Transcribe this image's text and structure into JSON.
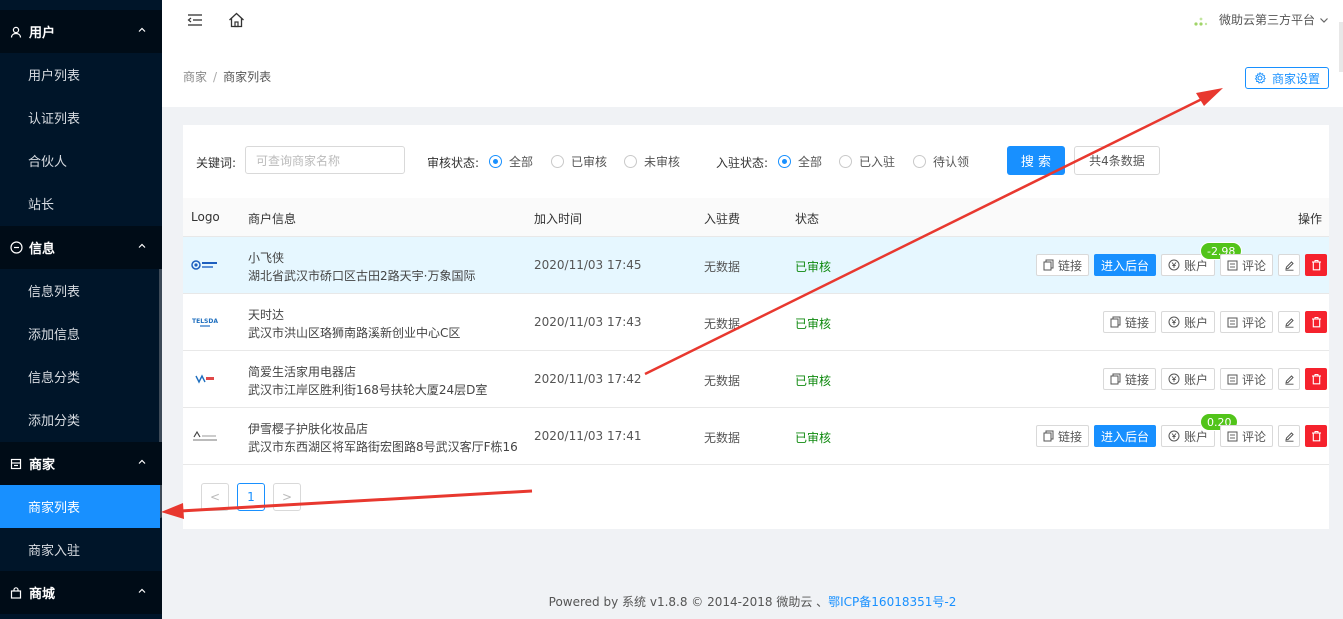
{
  "sidebar": {
    "groups": {
      "user": {
        "label": "用户",
        "items": [
          "用户列表",
          "认证列表",
          "合伙人",
          "站长"
        ]
      },
      "info": {
        "label": "信息",
        "items": [
          "信息列表",
          "添加信息",
          "信息分类",
          "添加分类"
        ]
      },
      "merchant": {
        "label": "商家",
        "items": [
          "商家列表",
          "商家入驻"
        ]
      },
      "mall": {
        "label": "商城"
      }
    }
  },
  "header": {
    "platform": "微助云第三方平台",
    "breadcrumb": {
      "root": "商家",
      "sep": "/",
      "current": "商家列表"
    },
    "settings_label": "商家设置"
  },
  "filters": {
    "keyword_label": "关键词:",
    "keyword_placeholder": "可查询商家名称",
    "audit_label": "审核状态:",
    "audit_options": [
      "全部",
      "已审核",
      "未审核"
    ],
    "entry_label": "入驻状态:",
    "entry_options": [
      "全部",
      "已入驻",
      "待认领"
    ],
    "search_label": "搜 索",
    "count_label": "共4条数据"
  },
  "table": {
    "headers": {
      "logo": "Logo",
      "info": "商户信息",
      "time": "加入时间",
      "fee": "入驻费",
      "status": "状态",
      "ops": "操作"
    },
    "rows": [
      {
        "name": "小飞侠",
        "address": "湖北省武汉市硚口区古田2路天宇·万象国际",
        "time": "2020/11/03 17:45",
        "fee": "无数据",
        "status": "已审核",
        "backend": "进入后台",
        "balance": "-2.98"
      },
      {
        "name": "天时达",
        "address": "武汉市洪山区珞狮南路溪新创业中心C区",
        "time": "2020/11/03 17:43",
        "fee": "无数据",
        "status": "已审核"
      },
      {
        "name": "简爱生活家用电器店",
        "address": "武汉市江岸区胜利街168号扶轮大厦24层D室",
        "time": "2020/11/03 17:42",
        "fee": "无数据",
        "status": "已审核"
      },
      {
        "name": "伊雪樱子护肤化妆品店",
        "address": "武汉市东西湖区将军路街宏图路8号武汉客厅F栋16",
        "time": "2020/11/03 17:41",
        "fee": "无数据",
        "status": "已审核",
        "backend": "进入后台",
        "balance": "0.20"
      }
    ],
    "actions": {
      "link": "链接",
      "account": "账户",
      "review": "评论"
    }
  },
  "pagination": {
    "prev": "<",
    "current": "1",
    "next": ">"
  },
  "footer": {
    "text": "Powered by 系统 v1.8.8 © 2014-2018 微助云 、",
    "icp": "鄂ICP备16018351号-2"
  },
  "colors": {
    "sidebar_bg": "#001529",
    "accent": "#1890ff",
    "status_ok": "#108a10",
    "danger": "#f5222d",
    "badge": "#52c41a",
    "annotation_arrow": "#e8382f"
  }
}
